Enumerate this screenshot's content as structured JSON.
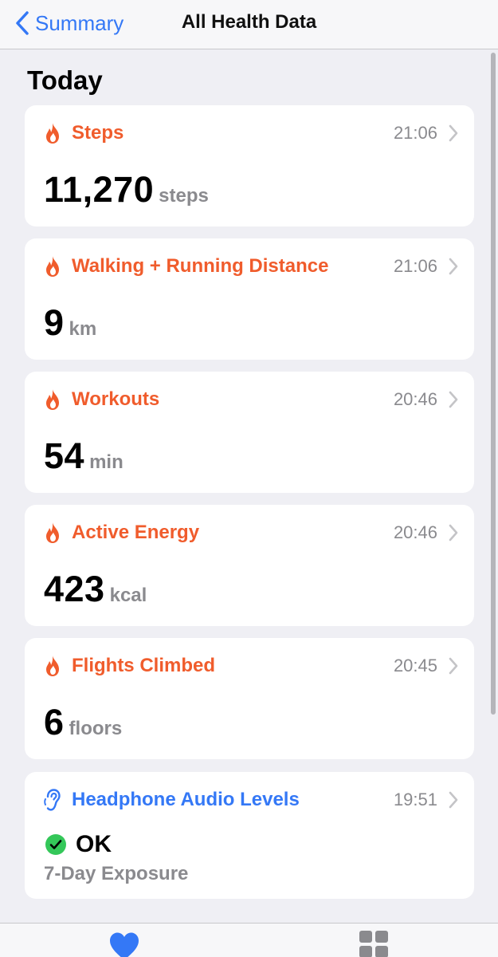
{
  "nav": {
    "back_label": "Summary",
    "title": "All Health Data"
  },
  "section": {
    "title": "Today"
  },
  "metrics": [
    {
      "name": "Steps",
      "time": "21:06",
      "value": "11,270",
      "unit": "steps"
    },
    {
      "name": "Walking + Running Distance",
      "time": "21:06",
      "value": "9",
      "unit": "km"
    },
    {
      "name": "Workouts",
      "time": "20:46",
      "value": "54",
      "unit": "min"
    },
    {
      "name": "Active Energy",
      "time": "20:46",
      "value": "423",
      "unit": "kcal"
    },
    {
      "name": "Flights Climbed",
      "time": "20:45",
      "value": "6",
      "unit": "floors"
    }
  ],
  "headphone": {
    "name": "Headphone Audio Levels",
    "time": "19:51",
    "status": "OK",
    "subtitle": "7-Day Exposure"
  },
  "icons": {
    "metric": "flame-icon",
    "headphone": "ear-icon",
    "tab_left": "heart-icon",
    "tab_right": "grid-icon"
  },
  "colors": {
    "accent": "#f05c2c",
    "link": "#3478f6",
    "ok": "#34c759",
    "secondary": "#8a8a8e",
    "background": "#efeff4"
  }
}
